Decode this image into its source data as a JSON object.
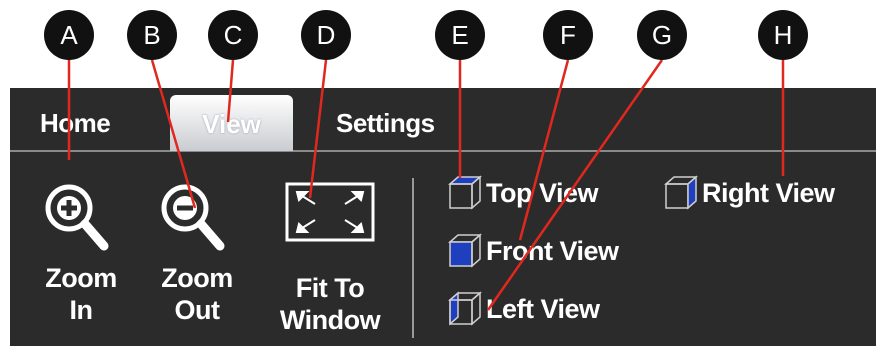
{
  "tabs": [
    {
      "label": "Home"
    },
    {
      "label": "View"
    },
    {
      "label": "Settings"
    }
  ],
  "zoom_group": {
    "zoom_in": "Zoom\nIn",
    "zoom_out": "Zoom\nOut",
    "fit": "Fit To\nWindow"
  },
  "views": {
    "top": "Top View",
    "front": "Front View",
    "left": "Left View",
    "right": "Right View"
  },
  "callouts": [
    "A",
    "B",
    "C",
    "D",
    "E",
    "F",
    "G",
    "H"
  ],
  "colors": {
    "ribbon_bg": "#2b2b2b",
    "callout_line": "#e0281e",
    "cube_face": "#1f3fbf"
  }
}
